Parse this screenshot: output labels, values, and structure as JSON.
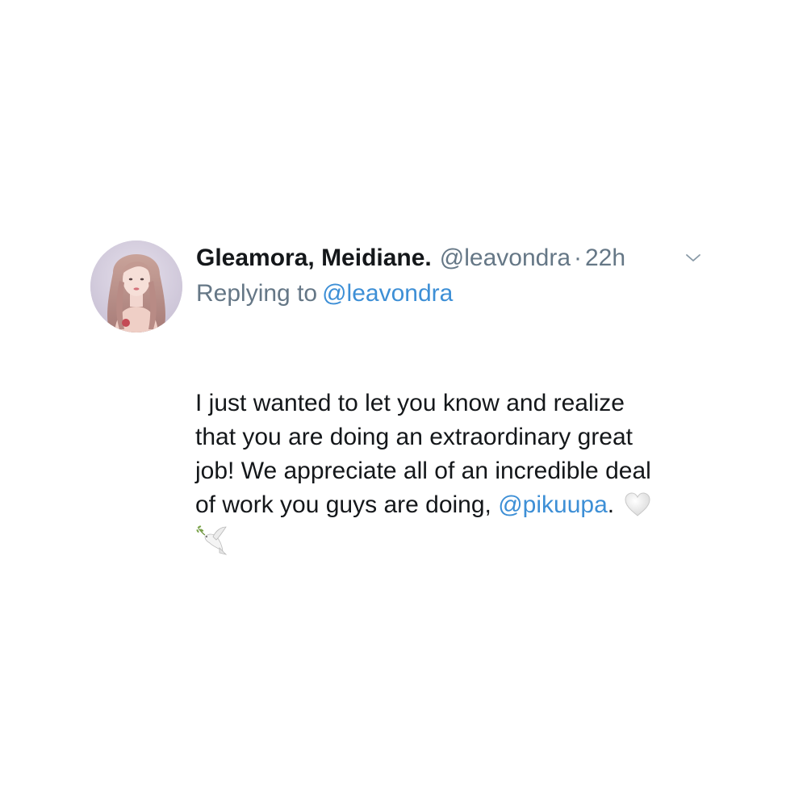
{
  "tweet": {
    "author": {
      "display_name": "Gleamora, Meidiane.",
      "handle": "@leavondra",
      "separator": "·",
      "time": "22h"
    },
    "replying_to": {
      "prefix": "Replying to",
      "handle": "@leavondra"
    },
    "body": {
      "text_line1": "I just wanted to let you know and realize",
      "text_line2": "that you are doing an extraordinary great",
      "text_line3": "job! We appreciate all of an incredible deal",
      "text_line4_pre": "of work you guys are doing, ",
      "mention": "@pikuupa",
      "text_line4_post": ".",
      "emojis": [
        "white-heart-icon",
        "dove-icon"
      ]
    },
    "icons": {
      "more_menu": "chevron-down-icon",
      "avatar": "avatar"
    },
    "colors": {
      "link": "#3d8fd6",
      "muted": "#657786",
      "text": "#14171a"
    }
  }
}
